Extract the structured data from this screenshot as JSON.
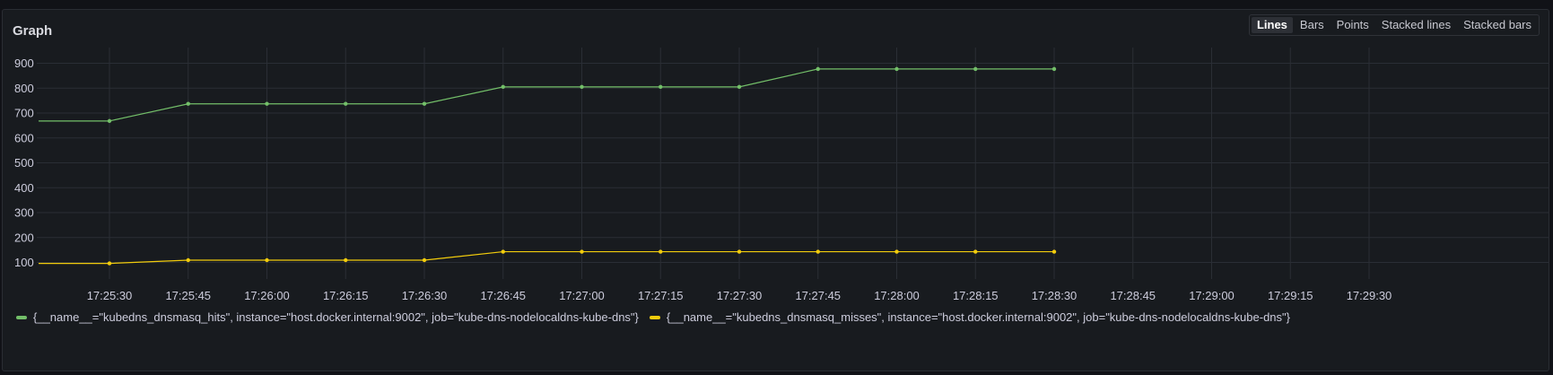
{
  "panel": {
    "title": "Graph",
    "display_modes": [
      {
        "label": "Lines",
        "active": true
      },
      {
        "label": "Bars",
        "active": false
      },
      {
        "label": "Points",
        "active": false
      },
      {
        "label": "Stacked lines",
        "active": false
      },
      {
        "label": "Stacked bars",
        "active": false
      }
    ]
  },
  "colors": {
    "hits": "#73bf69",
    "misses": "#f2cc0c",
    "grid": "#2a2e35",
    "axis_text": "#ccccdc"
  },
  "chart_data": {
    "type": "line",
    "ylim": [
      0,
      950
    ],
    "y_ticks": [
      100,
      200,
      300,
      400,
      500,
      600,
      700,
      800,
      900
    ],
    "x_ticks": [
      "17:25:30",
      "17:25:45",
      "17:26:00",
      "17:26:15",
      "17:26:30",
      "17:26:45",
      "17:27:00",
      "17:27:15",
      "17:27:30",
      "17:27:45",
      "17:28:00",
      "17:28:15",
      "17:28:30",
      "17:28:45",
      "17:29:00",
      "17:29:15",
      "17:29:30"
    ],
    "x_start": "17:25:21",
    "x_end": "17:29:31",
    "series": [
      {
        "name": "{__name__=\"kubedns_dnsmasq_hits\", instance=\"host.docker.internal:9002\", job=\"kube-dns-nodelocaldns-kube-dns\"}",
        "color_key": "hits",
        "x": [
          "17:25:21",
          "17:25:30",
          "17:25:45",
          "17:26:00",
          "17:26:15",
          "17:26:30",
          "17:26:45",
          "17:27:00",
          "17:27:15",
          "17:27:30",
          "17:27:45",
          "17:28:00",
          "17:28:15",
          "17:28:30"
        ],
        "values": [
          668,
          668,
          737,
          737,
          737,
          737,
          805,
          805,
          805,
          805,
          877,
          877,
          877,
          877
        ],
        "markers_from": 1
      },
      {
        "name": "{__name__=\"kubedns_dnsmasq_misses\", instance=\"host.docker.internal:9002\", job=\"kube-dns-nodelocaldns-kube-dns\"}",
        "color_key": "misses",
        "x": [
          "17:25:21",
          "17:25:30",
          "17:25:45",
          "17:26:00",
          "17:26:15",
          "17:26:30",
          "17:26:45",
          "17:27:00",
          "17:27:15",
          "17:27:30",
          "17:27:45",
          "17:28:00",
          "17:28:15",
          "17:28:30"
        ],
        "values": [
          96,
          96,
          109,
          109,
          109,
          109,
          143,
          143,
          143,
          143,
          143,
          143,
          143,
          143
        ],
        "markers_from": 1
      }
    ]
  },
  "legend": [
    {
      "label": "{__name__=\"kubedns_dnsmasq_hits\", instance=\"host.docker.internal:9002\", job=\"kube-dns-nodelocaldns-kube-dns\"}",
      "color_key": "hits"
    },
    {
      "label": "{__name__=\"kubedns_dnsmasq_misses\", instance=\"host.docker.internal:9002\", job=\"kube-dns-nodelocaldns-kube-dns\"}",
      "color_key": "misses"
    }
  ]
}
